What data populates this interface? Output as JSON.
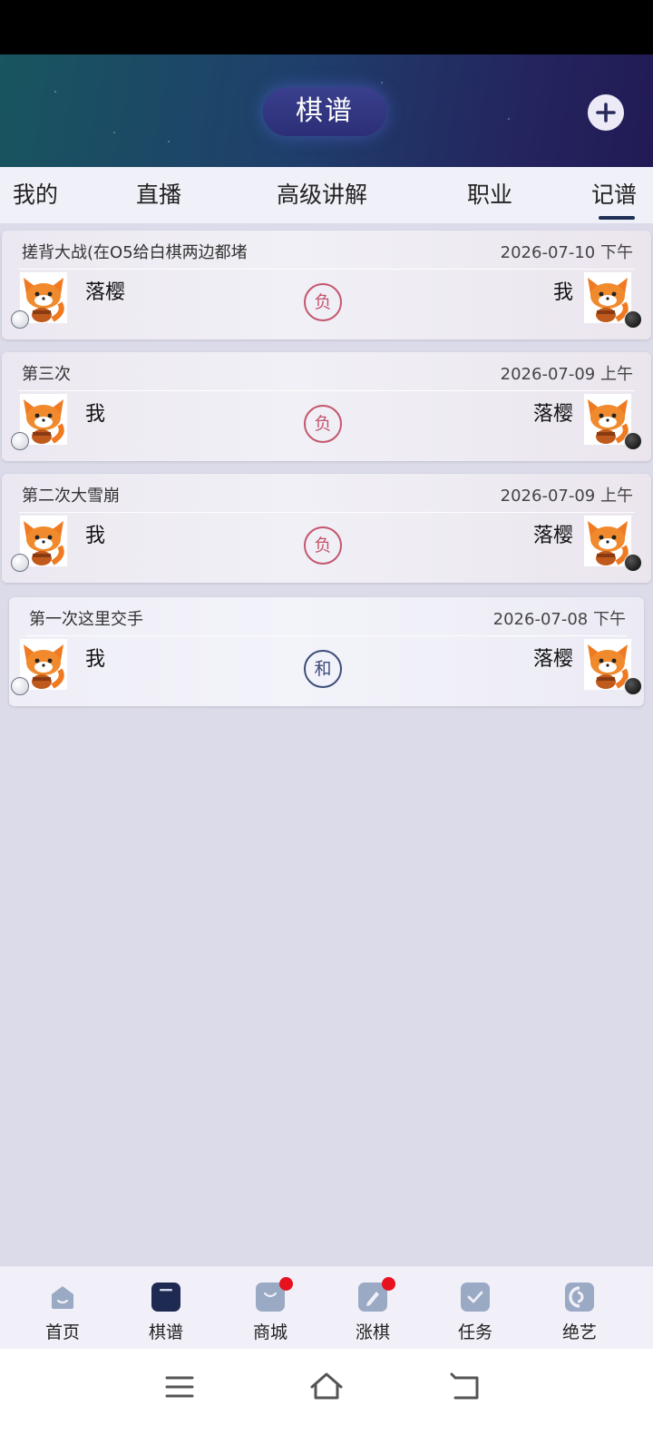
{
  "header": {
    "title": "棋谱"
  },
  "tabs": [
    {
      "label": "我的"
    },
    {
      "label": "直播"
    },
    {
      "label": "高级讲解"
    },
    {
      "label": "职业"
    },
    {
      "label": "记谱"
    }
  ],
  "active_tab": "记谱",
  "records": [
    {
      "title": "搓背大战(在O5给白棋两边都堵",
      "date": "2026-07-10 下午",
      "left_player": "落樱",
      "right_player": "我",
      "result": "负"
    },
    {
      "title": "第三次",
      "date": "2026-07-09 上午",
      "left_player": "我",
      "right_player": "落樱",
      "result": "负"
    },
    {
      "title": "第二次大雪崩",
      "date": "2026-07-09 上午",
      "left_player": "我",
      "right_player": "落樱",
      "result": "负"
    },
    {
      "title": "第一次这里交手",
      "date": "2026-07-08 下午",
      "left_player": "我",
      "right_player": "落樱",
      "result": "和"
    }
  ],
  "bottom_nav": [
    {
      "label": "首页",
      "icon": "home-icon"
    },
    {
      "label": "棋谱",
      "icon": "book-icon",
      "active": true
    },
    {
      "label": "商城",
      "icon": "shopping-bag-icon",
      "badge": true
    },
    {
      "label": "涨棋",
      "icon": "pencil-icon",
      "badge": true
    },
    {
      "label": "任务",
      "icon": "checklist-icon"
    },
    {
      "label": "绝艺",
      "icon": "jueyi-logo-icon"
    }
  ],
  "colors": {
    "loss": "#c4566e",
    "draw": "#3c4d78",
    "nav_active": "#1f2a52",
    "badge": "#e8121f"
  }
}
